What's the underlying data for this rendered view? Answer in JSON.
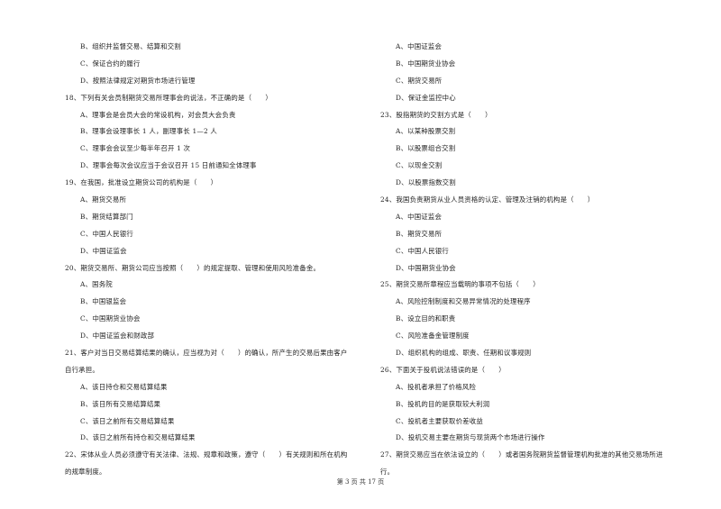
{
  "left_column": [
    {
      "type": "opt",
      "text": "B、组织并监督交易、结算和交割"
    },
    {
      "type": "opt",
      "text": "C、保证合约的履行"
    },
    {
      "type": "opt",
      "text": "D、按照法律规定对期货市场进行管理"
    },
    {
      "type": "q",
      "text": "18、下列有关会员制期货交易所理事会的说法，不正确的是（　　）"
    },
    {
      "type": "opt",
      "text": "A、理事会是会员大会的常设机构，对会员大会负责"
    },
    {
      "type": "opt",
      "text": "B、理事会设理事长 1 人，副理事长 1—2 人"
    },
    {
      "type": "opt",
      "text": "C、理事会会议至少每半年召开 1 次"
    },
    {
      "type": "opt",
      "text": "D、理事会每次会议应当于会议召开 15 日前通知全体理事"
    },
    {
      "type": "q",
      "text": "19、在我国，批准设立期货公司的机构是（　　）"
    },
    {
      "type": "opt",
      "text": "A、期货交易所"
    },
    {
      "type": "opt",
      "text": "B、期货结算部门"
    },
    {
      "type": "opt",
      "text": "C、中国人民银行"
    },
    {
      "type": "opt",
      "text": "D、中国证监会"
    },
    {
      "type": "q",
      "text": "20、期货交易所、期货公司应当按照（　　）的规定提取、管理和使用风险准备金。"
    },
    {
      "type": "opt",
      "text": "A、国务院"
    },
    {
      "type": "opt",
      "text": "B、中国银监会"
    },
    {
      "type": "opt",
      "text": "C、中国期货业协会"
    },
    {
      "type": "opt",
      "text": "D、中国证监会和财政部"
    },
    {
      "type": "q",
      "text": "21、客户对当日交易结算结果的确认，应当视为对（　　）的确认，所产生的交易后果由客户"
    },
    {
      "type": "cont",
      "text": "自行承担。"
    },
    {
      "type": "opt",
      "text": "A、该日持仓和交易结算结果"
    },
    {
      "type": "opt",
      "text": "B、该日所有交易结算结果"
    },
    {
      "type": "opt",
      "text": "C、该日之前所有交易结算结果"
    },
    {
      "type": "opt",
      "text": "D、该日之前所有持仓和交易结算结果"
    },
    {
      "type": "q",
      "text": "22、宋体从业人员必须遵守有关法律、法规、规章和政策，遵守（　　）有关规则和所在机构"
    },
    {
      "type": "cont",
      "text": "的规章制度。"
    }
  ],
  "right_column": [
    {
      "type": "opt",
      "text": "A、中国证监会"
    },
    {
      "type": "opt",
      "text": "B、中国期货业协会"
    },
    {
      "type": "opt",
      "text": "C、期货交易所"
    },
    {
      "type": "opt",
      "text": "D、保证金监控中心"
    },
    {
      "type": "q",
      "text": "23、股指期货的交割方式是（　　）"
    },
    {
      "type": "opt",
      "text": "A、以某种股票交割"
    },
    {
      "type": "opt",
      "text": "B、以股票组合交割"
    },
    {
      "type": "opt",
      "text": "C、以现金交割"
    },
    {
      "type": "opt",
      "text": "D、以股票指数交割"
    },
    {
      "type": "q",
      "text": "24、我国负责期货从业人员资格的认定、管理及注销的机构是（　　）"
    },
    {
      "type": "opt",
      "text": "A、中国证监会"
    },
    {
      "type": "opt",
      "text": "B、期货交易所"
    },
    {
      "type": "opt",
      "text": "C、中国人民银行"
    },
    {
      "type": "opt",
      "text": "D、中国期货业协会"
    },
    {
      "type": "q",
      "text": "25、期货交易所章程应当载明的事项不包括（　　）"
    },
    {
      "type": "opt",
      "text": "A、风险控制制度和交易异常情况的处理程序"
    },
    {
      "type": "opt",
      "text": "B、设立目的和职责"
    },
    {
      "type": "opt",
      "text": "C、风险准备金管理制度"
    },
    {
      "type": "opt",
      "text": "D、组织机构的组成、职责、任期和议事规则"
    },
    {
      "type": "q",
      "text": "26、下面关于投机说法错误的是（　　）"
    },
    {
      "type": "opt",
      "text": "A、投机者承担了价格风险"
    },
    {
      "type": "opt",
      "text": "B、投机的目的是获取较大利润"
    },
    {
      "type": "opt",
      "text": "C、投机者主要获取价差收益"
    },
    {
      "type": "opt",
      "text": "D、投机交易主要在期货与现货两个市场进行操作"
    },
    {
      "type": "q",
      "text": "27、期货交易应当在依法设立的（　　）或者国务院期货监督管理机构批准的其他交易场所进"
    },
    {
      "type": "cont",
      "text": "行。"
    }
  ],
  "footer": {
    "page_label": "第 3 页 共 17 页"
  }
}
